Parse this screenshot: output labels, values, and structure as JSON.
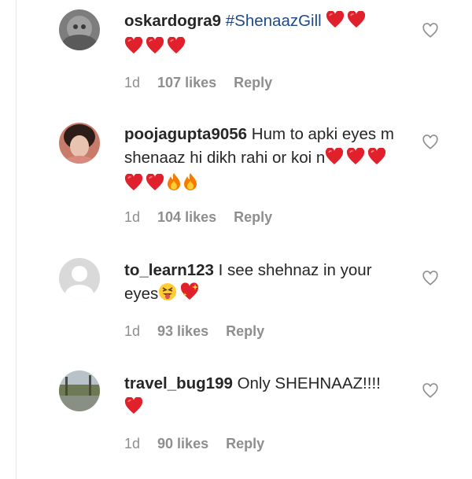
{
  "comments": [
    {
      "username": "oskardogra9",
      "hashtag": "#ShenaazGill",
      "time": "1d",
      "likes": "107 likes",
      "reply": "Reply"
    },
    {
      "username": "poojagupta9056",
      "text": "Hum to apki eyes m shenaaz hi dikh rahi or koi n",
      "time": "1d",
      "likes": "104 likes",
      "reply": "Reply"
    },
    {
      "username": "to_learn123",
      "text": "I see shehnaz in your eyes",
      "time": "1d",
      "likes": "93 likes",
      "reply": "Reply"
    },
    {
      "username": "travel_bug199",
      "text": "Only SHEHNAAZ!!!!",
      "time": "1d",
      "likes": "90 likes",
      "reply": "Reply"
    }
  ],
  "icons": {
    "like": "heart-outline-icon",
    "red_heart": "red-heart-emoji",
    "fire": "fire-emoji",
    "squint_tongue": "squinting-face-with-tongue-emoji",
    "sparkling_heart": "sparkling-heart-emoji"
  },
  "colors": {
    "text": "#262626",
    "meta": "#8e8e8e",
    "hashtag": "#1f4a87",
    "heart_red": "#e0202b"
  }
}
